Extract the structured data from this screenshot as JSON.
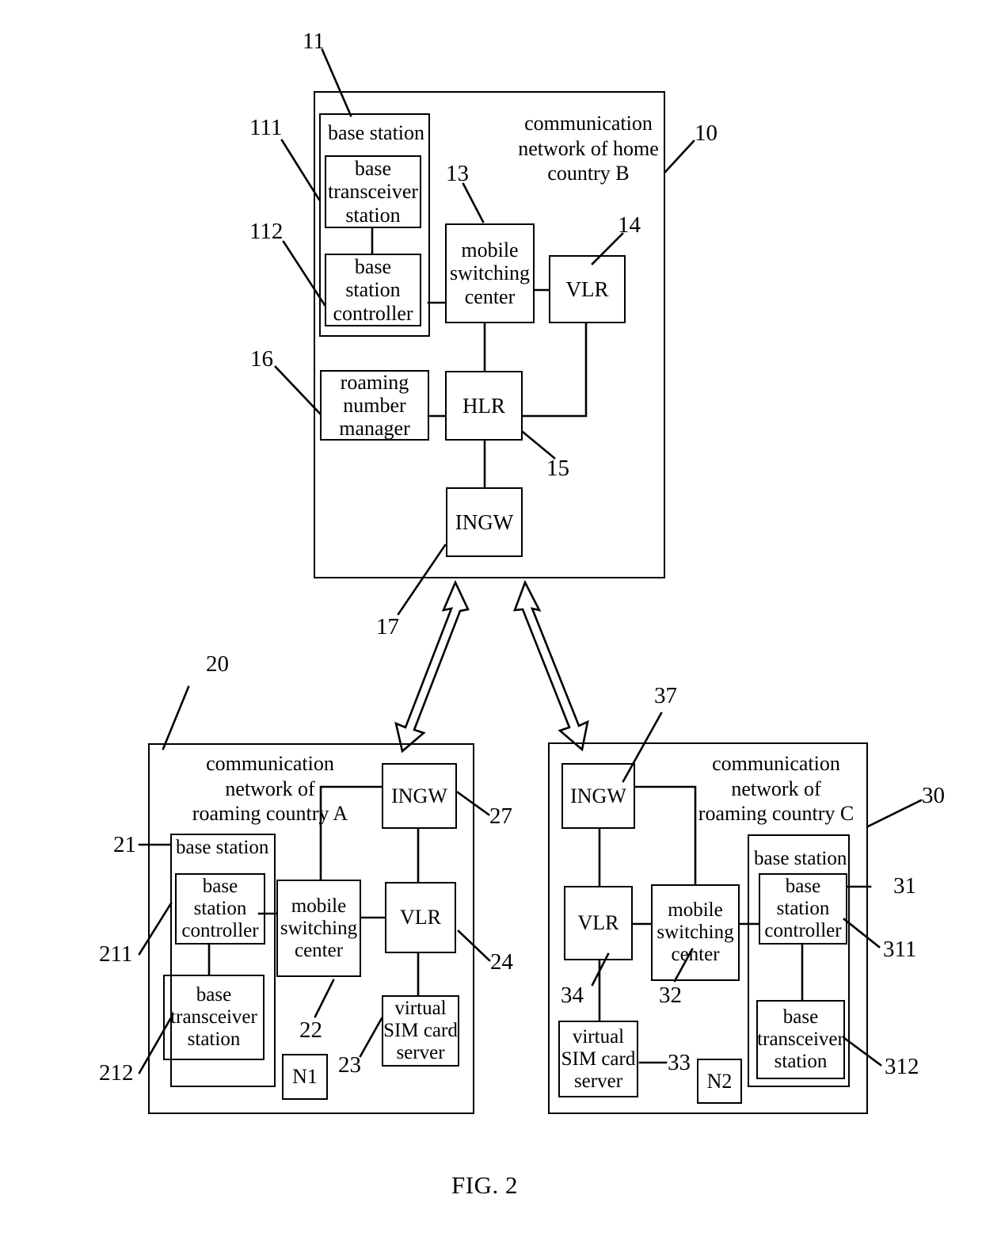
{
  "figure": {
    "caption": "FIG. 2"
  },
  "networks": {
    "home": {
      "ref": "10",
      "title": "communication\nnetwork of  home\ncountry B",
      "base_station": {
        "ref": "11",
        "label": "base station"
      },
      "bts": {
        "ref": "111",
        "label": "base\ntransceiver\nstation"
      },
      "bsc": {
        "ref": "112",
        "label": "base\nstation\ncontroller"
      },
      "msc": {
        "ref": "13",
        "label": "mobile\nswitching\ncenter"
      },
      "vlr": {
        "ref": "14",
        "label": "VLR"
      },
      "hlr": {
        "ref": "15",
        "label": "HLR"
      },
      "rnm": {
        "ref": "16",
        "label": "roaming\nnumber\nmanager"
      },
      "ingw": {
        "ref": "17",
        "label": "INGW"
      }
    },
    "roaming_a": {
      "ref": "20",
      "title": "communication\nnetwork of\nroaming country A",
      "base_station": {
        "ref": "21",
        "label": "base station"
      },
      "bsc": {
        "ref": "211",
        "label": "base\nstation\ncontroller"
      },
      "bts": {
        "ref": "212",
        "label": "base\ntransceiver\nstation"
      },
      "msc": {
        "ref": "22",
        "label": "mobile\nswitching\ncenter"
      },
      "vsim": {
        "ref": "23",
        "label": "virtual\nSIM card\nserver"
      },
      "vlr": {
        "ref": "24",
        "label": "VLR"
      },
      "ingw": {
        "ref": "27",
        "label": "INGW"
      },
      "node": {
        "label": "N1"
      }
    },
    "roaming_c": {
      "ref": "30",
      "title": "communication\nnetwork of\nroaming country C",
      "base_station": {
        "ref": "31",
        "label": "base station"
      },
      "bsc": {
        "ref": "311",
        "label": "base\nstation\ncontroller"
      },
      "bts": {
        "ref": "312",
        "label": "base\ntransceiver\nstation"
      },
      "msc": {
        "ref": "32",
        "label": "mobile\nswitching\ncenter"
      },
      "vsim": {
        "ref": "33",
        "label": "virtual\nSIM card\nserver"
      },
      "vlr": {
        "ref": "34",
        "label": "VLR"
      },
      "ingw": {
        "ref": "37",
        "label": "INGW"
      },
      "node": {
        "label": "N2"
      }
    }
  },
  "colors": {
    "stroke": "#000000",
    "background": "#ffffff"
  }
}
